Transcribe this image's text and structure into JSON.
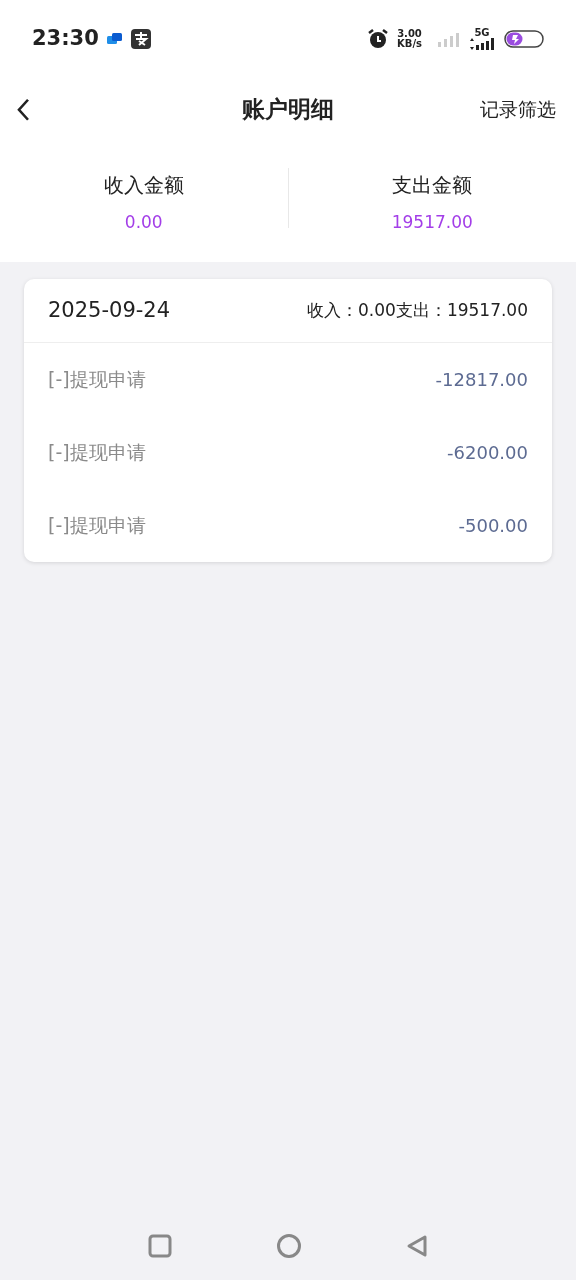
{
  "status_bar": {
    "time": "23:30",
    "speed_value": "3.00",
    "speed_unit": "KB/s",
    "network": "5G"
  },
  "header": {
    "title": "账户明细",
    "action": "记录筛选"
  },
  "summary": [
    {
      "label": "收入金额",
      "value": "0.00"
    },
    {
      "label": "支出金额",
      "value": "19517.00"
    }
  ],
  "groups": [
    {
      "date": "2025-09-24",
      "totals": "收入：0.00支出：19517.00",
      "records": [
        {
          "title": "[-]提现申请",
          "amount": "-12817.00"
        },
        {
          "title": "[-]提现申请",
          "amount": "-6200.00"
        },
        {
          "title": "[-]提现申请",
          "amount": "-500.00"
        }
      ]
    }
  ]
}
